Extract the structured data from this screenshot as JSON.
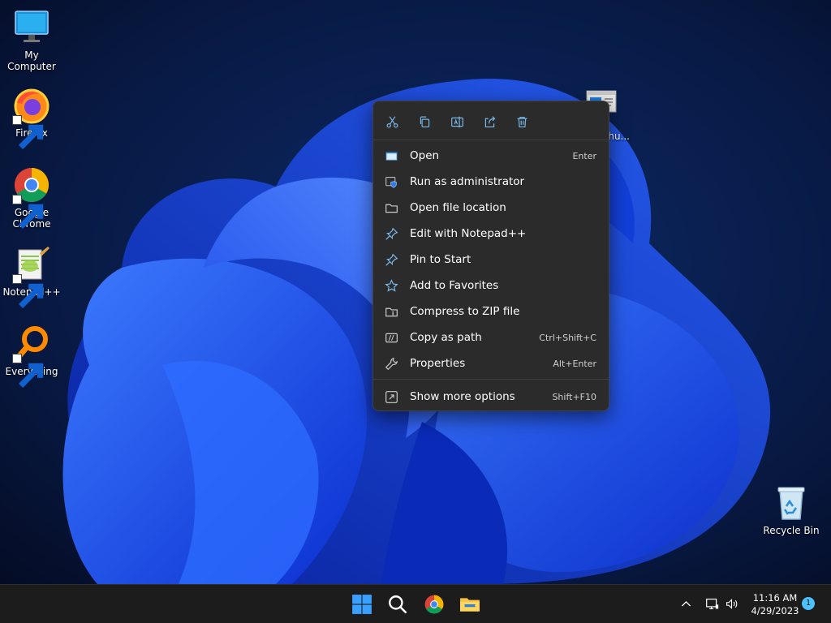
{
  "desktop": {
    "icons": [
      {
        "label": "My Computer",
        "icon": "monitor-icon"
      },
      {
        "label": "Firefox",
        "icon": "firefox-icon"
      },
      {
        "label": "Google Chrome",
        "icon": "chrome-icon"
      },
      {
        "label": "Notepad++",
        "icon": "notepadpp-icon"
      },
      {
        "label": "Everything",
        "icon": "everything-icon"
      },
      {
        "label": "Recycle Bin",
        "icon": "recycle-bin-icon"
      },
      {
        "label": "hu...",
        "icon": "file-shortcut-icon"
      }
    ]
  },
  "context_menu": {
    "toolbar": [
      {
        "action": "Cut",
        "icon": "cut-icon"
      },
      {
        "action": "Copy",
        "icon": "copy-icon"
      },
      {
        "action": "Rename",
        "icon": "rename-icon"
      },
      {
        "action": "Share",
        "icon": "share-icon"
      },
      {
        "action": "Delete",
        "icon": "delete-icon"
      }
    ],
    "items": [
      {
        "label": "Open",
        "shortcut": "Enter",
        "icon": "open-icon"
      },
      {
        "label": "Run as administrator",
        "shortcut": "",
        "icon": "shield-icon"
      },
      {
        "label": "Open file location",
        "shortcut": "",
        "icon": "folder-icon"
      },
      {
        "label": "Edit with Notepad++",
        "shortcut": "",
        "icon": "pin-icon"
      },
      {
        "label": "Pin to Start",
        "shortcut": "",
        "icon": "pin-icon"
      },
      {
        "label": "Add to Favorites",
        "shortcut": "",
        "icon": "star-icon"
      },
      {
        "label": "Compress to ZIP file",
        "shortcut": "",
        "icon": "zip-icon"
      },
      {
        "label": "Copy as path",
        "shortcut": "Ctrl+Shift+C",
        "icon": "path-icon"
      },
      {
        "label": "Properties",
        "shortcut": "Alt+Enter",
        "icon": "wrench-icon"
      },
      {
        "label": "Show more options",
        "shortcut": "Shift+F10",
        "icon": "more-options-icon"
      }
    ]
  },
  "taskbar": {
    "apps": [
      {
        "name": "Start",
        "icon": "windows-start-icon"
      },
      {
        "name": "Search",
        "icon": "search-icon"
      },
      {
        "name": "Google Chrome",
        "icon": "chrome-icon"
      },
      {
        "name": "File Explorer",
        "icon": "file-explorer-icon"
      }
    ],
    "tray": {
      "chevron_icon": "chevron-up-icon",
      "network_icon": "network-icon",
      "volume_icon": "volume-icon",
      "time": "11:16 AM",
      "date": "4/29/2023",
      "notification_count": "1"
    }
  },
  "colors": {
    "menu_bg": "#2b2b2b",
    "taskbar_bg": "#1c1c1c",
    "accent": "#4cc2ff",
    "wallpaper_bloom": "#1f5cff"
  }
}
